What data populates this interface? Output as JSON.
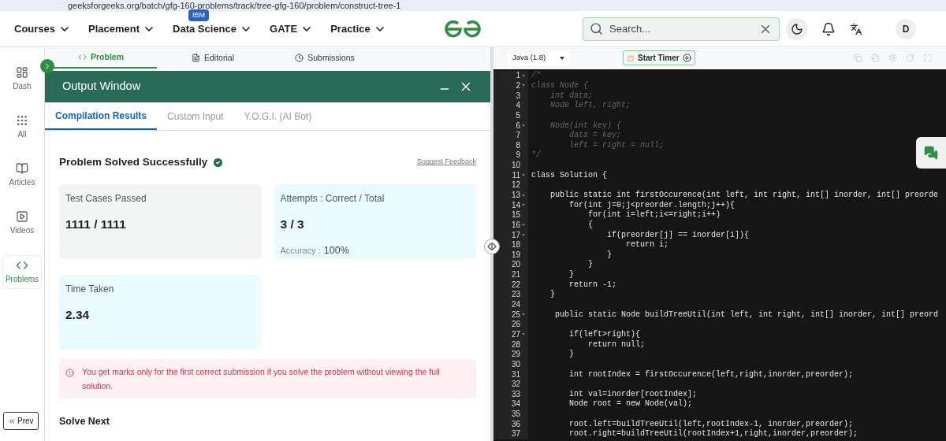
{
  "browser": {
    "url": "geeksforgeeks.org/batch/gfg-160-problems/track/tree-gfg-160/problem/construct-tree-1"
  },
  "nav": {
    "items": [
      {
        "label": "Courses"
      },
      {
        "label": "Placement"
      },
      {
        "label": "Data Science",
        "badge": "IBM"
      },
      {
        "label": "GATE"
      },
      {
        "label": "Practice"
      }
    ],
    "search": {
      "placeholder": "Search..."
    },
    "avatar": "D"
  },
  "sidebar": {
    "items": [
      {
        "label": "Dash",
        "selected": false
      },
      {
        "label": "All",
        "selected": false
      },
      {
        "label": "Articles",
        "selected": false
      },
      {
        "label": "Videos",
        "selected": false
      },
      {
        "label": "Problems",
        "selected": true
      }
    ],
    "prev": "Prev"
  },
  "problem_tabs": [
    {
      "label": "Problem",
      "selected": true
    },
    {
      "label": "Editorial",
      "selected": false
    },
    {
      "label": "Submissions",
      "selected": false
    }
  ],
  "output": {
    "title": "Output Window",
    "tabs": [
      {
        "label": "Compilation Results",
        "selected": true
      },
      {
        "label": "Custom Input",
        "selected": false
      },
      {
        "label": "Y.O.G.I. (AI Bot)",
        "selected": false
      }
    ],
    "status": "Problem Solved Successfully",
    "feedback": "Suggest Feedback",
    "cards": [
      {
        "label": "Test Cases Passed",
        "value": "1111 / 1111"
      },
      {
        "label": "Attempts : Correct / Total",
        "value": "3 / 3",
        "note_label": "Accuracy :",
        "note_value": "100%"
      },
      {
        "label": "Time Taken",
        "value": "2.34"
      }
    ],
    "warning": "You get marks only for the first correct submission if you solve the problem without viewing the full solution.",
    "solve_next": "Solve Next"
  },
  "editor": {
    "language": "Java (1.8)",
    "timer": "Start Timer",
    "lines": [
      {
        "n": "1",
        "text": "/*",
        "kind": "comment",
        "fold": true
      },
      {
        "n": "2",
        "text": "class Node {",
        "kind": "comment",
        "fold": true
      },
      {
        "n": "3",
        "text": "    int data;",
        "kind": "comment",
        "fold": false
      },
      {
        "n": "4",
        "text": "    Node left, right;",
        "kind": "comment",
        "fold": false
      },
      {
        "n": "5",
        "fold": false
      },
      {
        "n": "6",
        "text": "    Node(int key) {",
        "kind": "comment",
        "fold": true
      },
      {
        "n": "7",
        "text": "        data = key;",
        "kind": "comment",
        "fold": false
      },
      {
        "n": "8",
        "text": "        left = right = null;",
        "kind": "comment",
        "fold": false
      },
      {
        "n": "9",
        "text": "*/",
        "kind": "comment",
        "fold": false
      },
      {
        "n": "10",
        "fold": false
      },
      {
        "n": "11",
        "text": "class Solution {",
        "kind": "code",
        "fold": true
      },
      {
        "n": "12",
        "fold": false
      },
      {
        "n": "13",
        "text": "    public static int firstOccurence(int left, int right, int[] inorder, int[] preorde",
        "kind": "code",
        "fold": true
      },
      {
        "n": "14",
        "text": "        for(int j=0;j<preorder.length;j++){",
        "kind": "code",
        "fold": true
      },
      {
        "n": "15",
        "text": "            for(int i=left;i<=right;i++)",
        "kind": "code",
        "fold": false
      },
      {
        "n": "16",
        "text": "            {",
        "kind": "code",
        "fold": true
      },
      {
        "n": "17",
        "text": "                if(preorder[j] == inorder[i]){",
        "kind": "code",
        "fold": true
      },
      {
        "n": "18",
        "text": "                    return i;",
        "kind": "code",
        "fold": false
      },
      {
        "n": "19",
        "text": "                }",
        "kind": "code",
        "fold": false
      },
      {
        "n": "20",
        "text": "            }",
        "kind": "code",
        "fold": false
      },
      {
        "n": "21",
        "text": "        }",
        "kind": "code",
        "fold": false
      },
      {
        "n": "22",
        "text": "        return -1;",
        "kind": "code",
        "fold": false
      },
      {
        "n": "23",
        "text": "    }",
        "kind": "code",
        "fold": false
      },
      {
        "n": "24",
        "fold": false
      },
      {
        "n": "25",
        "text": "     public static Node buildTreeUtil(int left, int right, int[] inorder, int[] preord",
        "kind": "code",
        "fold": true
      },
      {
        "n": "26",
        "fold": false
      },
      {
        "n": "27",
        "text": "        if(left>right){",
        "kind": "code",
        "fold": true
      },
      {
        "n": "28",
        "text": "            return null;",
        "kind": "code",
        "fold": false
      },
      {
        "n": "29",
        "text": "        }",
        "kind": "code",
        "fold": false
      },
      {
        "n": "30",
        "fold": false
      },
      {
        "n": "31",
        "text": "        int rootIndex = firstOccurence(left,right,inorder,preorder);",
        "kind": "code",
        "fold": false
      },
      {
        "n": "32",
        "fold": false
      },
      {
        "n": "33",
        "text": "        int val=inorder[rootIndex];",
        "kind": "code",
        "fold": false
      },
      {
        "n": "34",
        "text": "        Node root = new Node(val);",
        "kind": "code",
        "fold": false
      },
      {
        "n": "35",
        "fold": false
      },
      {
        "n": "36",
        "text": "        root.left=buildTreeUtil(left,rootIndex-1, inorder,preorder);",
        "kind": "code",
        "fold": false
      },
      {
        "n": "37",
        "text": "        root.right=buildTreeUtil(rootIndex+1,right,inorder,preorder);",
        "kind": "code",
        "fold": false
      }
    ]
  }
}
